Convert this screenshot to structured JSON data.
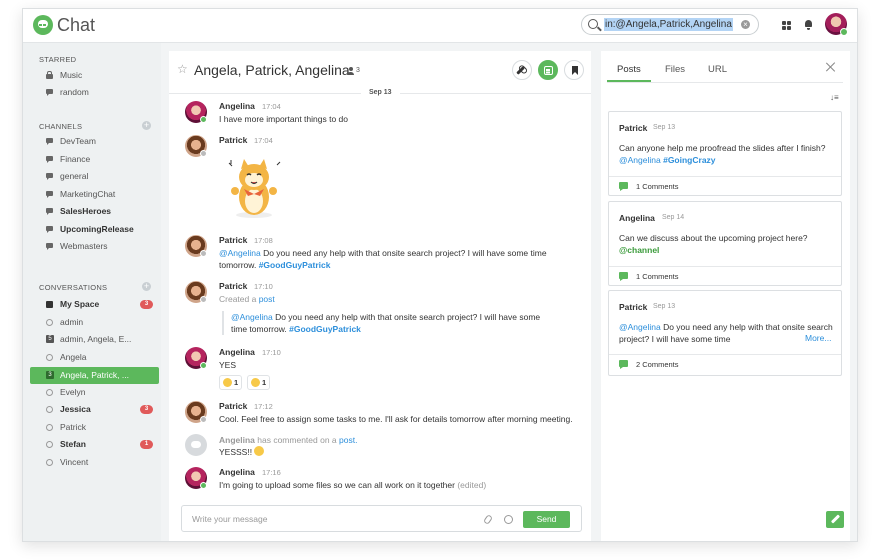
{
  "header": {
    "app_title": "Chat",
    "search_value": "in:@Angela,Patrick,Angelina"
  },
  "sidebar": {
    "starred_title": "STARRED",
    "starred": [
      {
        "label": "Music",
        "icon": "lock-icon"
      },
      {
        "label": "random",
        "icon": "channel-icon"
      }
    ],
    "channels_title": "CHANNELS",
    "channels": [
      {
        "label": "DevTeam",
        "bold": false
      },
      {
        "label": "Finance",
        "bold": false
      },
      {
        "label": "general",
        "bold": false
      },
      {
        "label": "MarketingChat",
        "bold": false
      },
      {
        "label": "SalesHeroes",
        "bold": true
      },
      {
        "label": "UpcomingRelease",
        "bold": true
      },
      {
        "label": "Webmasters",
        "bold": false
      }
    ],
    "conversations_title": "CONVERSATIONS",
    "conversations": [
      {
        "label": "My Space",
        "icon": "inbox-icon",
        "bold": true,
        "badge": "3"
      },
      {
        "label": "admin",
        "icon": "status-circle-icon",
        "bold": false,
        "badge": ""
      },
      {
        "label": "admin, Angela, E...",
        "icon": "group-count-icon",
        "num": "5",
        "bold": false,
        "badge": ""
      },
      {
        "label": "Angela",
        "icon": "status-circle-icon",
        "bold": false,
        "badge": ""
      },
      {
        "label": "Angela, Patrick, ...",
        "icon": "group-count-icon",
        "num": "3",
        "bold": false,
        "badge": "",
        "active": true
      },
      {
        "label": "Evelyn",
        "icon": "status-circle-icon",
        "bold": false,
        "badge": ""
      },
      {
        "label": "Jessica",
        "icon": "status-circle-icon",
        "bold": true,
        "badge": "3"
      },
      {
        "label": "Patrick",
        "icon": "status-circle-icon",
        "bold": false,
        "badge": ""
      },
      {
        "label": "Stefan",
        "icon": "status-circle-icon",
        "bold": true,
        "badge": "1"
      },
      {
        "label": "Vincent",
        "icon": "status-circle-icon",
        "bold": false,
        "badge": ""
      }
    ]
  },
  "chat": {
    "title": "Angela, Patrick, Angelina",
    "member_count": "3",
    "date_separator": "Sep 13",
    "messages": {
      "m1": {
        "author": "Angelina",
        "time": "17:04",
        "text": "I have more important things to do"
      },
      "m2": {
        "author": "Patrick",
        "time": "17:04"
      },
      "m3": {
        "author": "Patrick",
        "time": "17:08",
        "mention": "@Angelina",
        "text": " Do you need any help with that onsite search project? I will have some time tomorrow. ",
        "tag": "#GoodGuyPatrick"
      },
      "m4": {
        "author": "Patrick",
        "time": "17:10",
        "created_prefix": "Created a ",
        "created_link": "post",
        "quote_mention": "@Angelina",
        "quote_text": " Do you need any help with that onsite search project? I will have some time tomorrow. ",
        "quote_tag": "#GoodGuyPatrick"
      },
      "m5": {
        "author": "Angelina",
        "time": "17:10",
        "text": "YES",
        "reactions": [
          {
            "count": "1"
          },
          {
            "count": "1"
          }
        ]
      },
      "m6": {
        "author": "Patrick",
        "time": "17:12",
        "text": "Cool. Feel free to assign some tasks to me. I'll ask for details tomorrow after morning meeting."
      },
      "m7": {
        "author": "Angelina",
        "suffix": " has commented on a ",
        "link": "post.",
        "text": "YESSS!! "
      },
      "m8": {
        "author": "Angelina",
        "time": "17:16",
        "text": "I'm going to upload some files so we can all work on it together ",
        "edited": "(edited)"
      }
    },
    "compose_placeholder": "Write your message",
    "send_label": "Send"
  },
  "rpanel": {
    "tabs": [
      "Posts",
      "Files",
      "URL"
    ],
    "cards": [
      {
        "author": "Patrick",
        "date": "Sep 13",
        "text": "Can anyone help me proofread the slides after I finish? ",
        "mention": "@Angelina",
        "tag": "#GoingCrazy",
        "comments": "1 Comments"
      },
      {
        "author": "Angelina",
        "date": "Sep 14",
        "text": "Can we discuss about the upcoming project here? ",
        "tag": "@channel",
        "comments": "1 Comments"
      },
      {
        "author": "Patrick",
        "date": "Sep 13",
        "mention": "@Angelina",
        "text": " Do you need any help with that onsite search project? I will have some time",
        "more": "More...",
        "comments": "2 Comments"
      }
    ]
  },
  "colors": {
    "accent": "#5cb85c",
    "link": "#2d8fdb",
    "badge": "#e05a5a"
  }
}
